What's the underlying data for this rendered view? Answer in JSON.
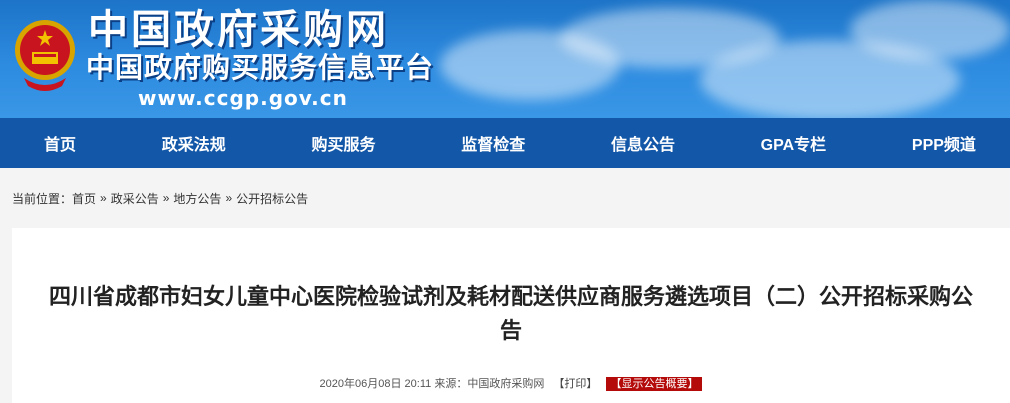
{
  "header": {
    "title": "中国政府采购网",
    "subtitle": "中国政府购买服务信息平台",
    "url": "www.ccgp.gov.cn"
  },
  "nav": {
    "items": [
      {
        "label": "首页"
      },
      {
        "label": "政采法规"
      },
      {
        "label": "购买服务"
      },
      {
        "label": "监督检查"
      },
      {
        "label": "信息公告"
      },
      {
        "label": "GPA专栏"
      },
      {
        "label": "PPP频道"
      }
    ]
  },
  "breadcrumb": {
    "prefix": "当前位置：",
    "items": [
      "首页",
      "政采公告",
      "地方公告",
      "公开招标公告"
    ],
    "separator": "»"
  },
  "article": {
    "title": "四川省成都市妇女儿童中心医院检验试剂及耗材配送供应商服务遴选项目（二）公开招标采购公告",
    "datetime": "2020年06月08日 20:11",
    "source_label": "来源：",
    "source": "中国政府采购网",
    "print_label": "【打印】",
    "summary_label": "【显示公告概要】"
  },
  "colors": {
    "nav_bg": "#1257a8",
    "header_bg": "#2d8be0",
    "summary_bg": "#b40a0a"
  }
}
